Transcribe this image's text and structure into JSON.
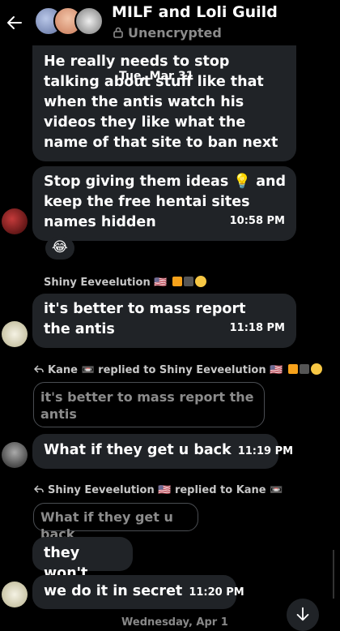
{
  "header": {
    "title": "MILF and Loli Guild",
    "subtitle": "Unencrypted"
  },
  "date_separator": "Tue, Mar 31",
  "messages": [
    {
      "text": "He really needs to stop talking about stuff like that when the antis watch his videos they like what the name of that site to ban next"
    },
    {
      "text": "Stop giving them ideas 💡 and keep the free hentai sites names hidden",
      "time": "10:58 PM",
      "reaction": "😂"
    },
    {
      "sender": "Shiny Eeveelution 🇺🇸",
      "text": "it's better to mass report the antis",
      "time": "11:18 PM"
    },
    {
      "reply_to": "Kane 📼 replied to Shiny Eeveelution 🇺🇸",
      "quote": "it's better to mass report the antis",
      "text": "What if they get u back",
      "time": "11:19 PM"
    },
    {
      "reply_to": "Shiny Eeveelution 🇺🇸 replied to Kane 📼",
      "quote": "What if they get u back",
      "text": "they won't"
    },
    {
      "text": "we do it in secret",
      "time": "11:20 PM"
    }
  ],
  "footer_peek": "Wednesday, Apr 1",
  "colors": {
    "background": "#000000",
    "bubble": "#202327",
    "muted": "#8b8b8b"
  }
}
